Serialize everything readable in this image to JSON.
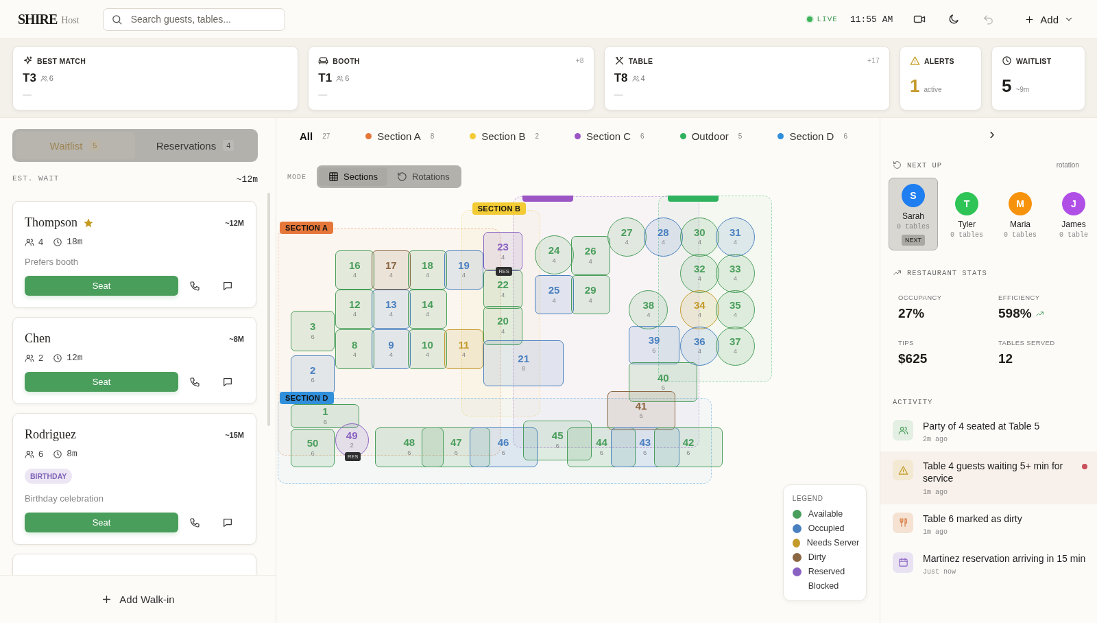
{
  "header": {
    "logo": "SHIRE",
    "logo_sub": "Host",
    "search": {
      "placeholder": "Search guests, tables..."
    },
    "live": "LIVE",
    "time": "11:55 AM",
    "add": "Add"
  },
  "match_cards": [
    {
      "kind": "best",
      "label": "BEST MATCH",
      "table": "T3",
      "seats": "6",
      "note": "—"
    },
    {
      "kind": "booth",
      "label": "BOOTH",
      "more": "+8",
      "table": "T1",
      "seats": "6",
      "note": "—"
    },
    {
      "kind": "table",
      "label": "TABLE",
      "more": "+17",
      "table": "T8",
      "seats": "4",
      "note": "—"
    }
  ],
  "stat_cards": [
    {
      "kind": "alerts",
      "label": "ALERTS",
      "value": "1",
      "sub": "active"
    },
    {
      "kind": "waitlist",
      "label": "WAITLIST",
      "value": "5",
      "sub": "~9m"
    }
  ],
  "left": {
    "tabs": [
      {
        "label": "Waitlist",
        "count": "5",
        "selected": true
      },
      {
        "label": "Reservations",
        "count": "4",
        "selected": false
      }
    ],
    "est_wait": {
      "label": "EST. WAIT",
      "value": "~12m"
    },
    "parties": [
      {
        "name": "Thompson",
        "vip": true,
        "wait": "~12M",
        "size": "4",
        "elapsed": "18m",
        "note": "Prefers booth",
        "seat": "Seat"
      },
      {
        "name": "Chen",
        "vip": false,
        "wait": "~8M",
        "size": "2",
        "elapsed": "12m",
        "seat": "Seat"
      },
      {
        "name": "Rodriguez",
        "vip": false,
        "wait": "~15M",
        "size": "6",
        "elapsed": "8m",
        "tag": "BIRTHDAY",
        "note": "Birthday celebration",
        "seat": "Seat"
      }
    ],
    "add_walk_in": "Add Walk-in"
  },
  "filters": [
    {
      "label": "All",
      "count": "27",
      "selected": true
    },
    {
      "label": "Section A",
      "count": "8",
      "color": "#e5773a",
      "selected": false
    },
    {
      "label": "Section B",
      "count": "2",
      "color": "#f2cb35",
      "selected": false
    },
    {
      "label": "Section C",
      "count": "6",
      "color": "#9b55c4",
      "selected": false
    },
    {
      "label": "Outdoor",
      "count": "5",
      "color": "#2fb25e",
      "selected": false
    },
    {
      "label": "Section D",
      "count": "6",
      "color": "#2f8fdb",
      "selected": false
    }
  ],
  "mode": {
    "label": "MODE",
    "options": [
      {
        "kind": "sections",
        "label": "Sections",
        "selected": true
      },
      {
        "kind": "rotations",
        "label": "Rotations",
        "selected": false
      }
    ]
  },
  "sections": [
    {
      "label": "SECTION A",
      "color": "#e5773a"
    },
    {
      "label": "SECTION B",
      "color": "#f2cb35"
    },
    {
      "color": "#9b55c4"
    },
    {
      "color": "#2fb25e"
    },
    {
      "label": "SECTION D",
      "color": "#2f8fdb"
    }
  ],
  "tables": [
    {
      "number": "23",
      "seats": "4",
      "kind": "square",
      "color": "#8a63c2",
      "badge": "RES"
    },
    {
      "number": "24",
      "seats": "4",
      "kind": "round",
      "color": "#4a9e5c"
    },
    {
      "number": "26",
      "seats": "4",
      "kind": "square",
      "color": "#4a9e5c"
    },
    {
      "number": "27",
      "seats": "4",
      "kind": "round",
      "color": "#4a9e5c"
    },
    {
      "number": "28",
      "seats": "4",
      "kind": "round",
      "color": "#4a80c0"
    },
    {
      "number": "30",
      "seats": "4",
      "kind": "round",
      "color": "#4a9e5c"
    },
    {
      "number": "31",
      "seats": "4",
      "kind": "round",
      "color": "#4a80c0"
    },
    {
      "number": "16",
      "seats": "4",
      "kind": "square",
      "color": "#4a9e5c"
    },
    {
      "number": "17",
      "seats": "4",
      "kind": "square",
      "color": "#8b6642"
    },
    {
      "number": "18",
      "seats": "4",
      "kind": "square",
      "color": "#4a9e5c"
    },
    {
      "number": "19",
      "seats": "4",
      "kind": "square",
      "color": "#4a80c0"
    },
    {
      "number": "32",
      "seats": "4",
      "kind": "round",
      "color": "#4a9e5c"
    },
    {
      "number": "33",
      "seats": "4",
      "kind": "round",
      "color": "#4a9e5c"
    },
    {
      "number": "22",
      "seats": "4",
      "kind": "square",
      "color": "#4a9e5c"
    },
    {
      "number": "25",
      "seats": "4",
      "kind": "square",
      "color": "#4a80c0"
    },
    {
      "number": "29",
      "seats": "4",
      "kind": "square",
      "color": "#4a9e5c"
    },
    {
      "number": "12",
      "seats": "4",
      "kind": "square",
      "color": "#4a9e5c"
    },
    {
      "number": "13",
      "seats": "4",
      "kind": "square",
      "color": "#4a80c0"
    },
    {
      "number": "14",
      "seats": "4",
      "kind": "square",
      "color": "#4a9e5c"
    },
    {
      "number": "38",
      "seats": "4",
      "kind": "round",
      "color": "#4a9e5c"
    },
    {
      "number": "34",
      "seats": "4",
      "kind": "round",
      "color": "#c49a2a"
    },
    {
      "number": "35",
      "seats": "4",
      "kind": "round",
      "color": "#4a9e5c"
    },
    {
      "number": "3",
      "seats": "6",
      "kind": "rect",
      "color": "#4a9e5c"
    },
    {
      "number": "20",
      "seats": "4",
      "kind": "square",
      "color": "#4a9e5c"
    },
    {
      "number": "8",
      "seats": "4",
      "kind": "square",
      "color": "#4a9e5c"
    },
    {
      "number": "9",
      "seats": "4",
      "kind": "square",
      "color": "#4a80c0"
    },
    {
      "number": "10",
      "seats": "4",
      "kind": "square",
      "color": "#4a9e5c"
    },
    {
      "number": "11",
      "seats": "4",
      "kind": "square",
      "color": "#c49a2a"
    },
    {
      "number": "39",
      "seats": "6",
      "kind": "rect",
      "color": "#4a80c0"
    },
    {
      "number": "36",
      "seats": "4",
      "kind": "round",
      "color": "#4a80c0"
    },
    {
      "number": "37",
      "seats": "4",
      "kind": "round",
      "color": "#4a9e5c"
    },
    {
      "number": "21",
      "seats": "8",
      "kind": "rect",
      "color": "#4a80c0"
    },
    {
      "number": "2",
      "seats": "6",
      "kind": "rect",
      "color": "#4a80c0"
    },
    {
      "number": "40",
      "seats": "6",
      "kind": "rect",
      "color": "#4a9e5c"
    },
    {
      "number": "41",
      "seats": "6",
      "kind": "rect",
      "color": "#8b6642"
    },
    {
      "number": "1",
      "seats": "6",
      "kind": "rect",
      "color": "#4a9e5c"
    },
    {
      "number": "50",
      "seats": "6",
      "kind": "rect",
      "color": "#4a9e5c"
    },
    {
      "number": "49",
      "seats": "2",
      "kind": "round",
      "color": "#8a63c2",
      "badge": "RES"
    },
    {
      "number": "48",
      "seats": "6",
      "kind": "rect",
      "color": "#4a9e5c"
    },
    {
      "number": "47",
      "seats": "6",
      "kind": "rect",
      "color": "#4a9e5c"
    },
    {
      "number": "46",
      "seats": "6",
      "kind": "rect",
      "color": "#4a80c0"
    },
    {
      "number": "45",
      "seats": "6",
      "kind": "rect",
      "color": "#4a9e5c"
    },
    {
      "number": "44",
      "seats": "6",
      "kind": "rect",
      "color": "#4a9e5c"
    },
    {
      "number": "43",
      "seats": "6",
      "kind": "rect",
      "color": "#4a80c0"
    },
    {
      "number": "42",
      "seats": "6",
      "kind": "rect",
      "color": "#4a9e5c"
    }
  ],
  "legend": {
    "title": "LEGEND",
    "items": [
      {
        "label": "Available",
        "color": "#4a9e5c"
      },
      {
        "label": "Occupied",
        "color": "#4a80c0"
      },
      {
        "label": "Needs Server",
        "color": "#c49a2a"
      },
      {
        "label": "Dirty",
        "color": "#8b6642"
      },
      {
        "label": "Reserved",
        "color": "#8a63c2"
      },
      {
        "label": "Blocked"
      }
    ]
  },
  "right": {
    "collapse": "›",
    "next_up": {
      "title": "NEXT UP",
      "mode": "rotation",
      "servers": [
        {
          "initial": "S",
          "name": "Sarah",
          "tables": "0 tables",
          "color": "#1f7ef0",
          "selected": true,
          "badge": "NEXT"
        },
        {
          "initial": "T",
          "name": "Tyler",
          "tables": "0 tables",
          "color": "#2fc456",
          "selected": false
        },
        {
          "initial": "M",
          "name": "Maria",
          "tables": "0 tables",
          "color": "#f7920d",
          "selected": false
        },
        {
          "initial": "J",
          "name": "James",
          "tables": "0 table",
          "color": "#b04fe6",
          "selected": false
        }
      ]
    },
    "stats": {
      "title": "RESTAURANT STATS",
      "items": [
        {
          "label": "OCCUPANCY",
          "value": "27%"
        },
        {
          "label": "EFFICIENCY",
          "value": "598%",
          "trending_up": true
        },
        {
          "label": "TIPS",
          "value": "$625"
        },
        {
          "label": "TABLES SERVED",
          "value": "12"
        }
      ]
    },
    "activity": {
      "title": "ACTIVITY",
      "items": [
        {
          "kind": "seated",
          "text": "Party of 4 seated at Table 5",
          "time": "2m ago",
          "unread": false
        },
        {
          "kind": "alert",
          "text": "Table 4 guests waiting 5+ min for service",
          "time": "1m ago",
          "unread": true
        },
        {
          "kind": "dirty",
          "text": "Table 6 marked as dirty",
          "time": "1m ago",
          "unread": false
        },
        {
          "kind": "reservation",
          "text": "Martinez reservation arriving in 15 min",
          "time": "Just now",
          "unread": false
        }
      ]
    }
  }
}
